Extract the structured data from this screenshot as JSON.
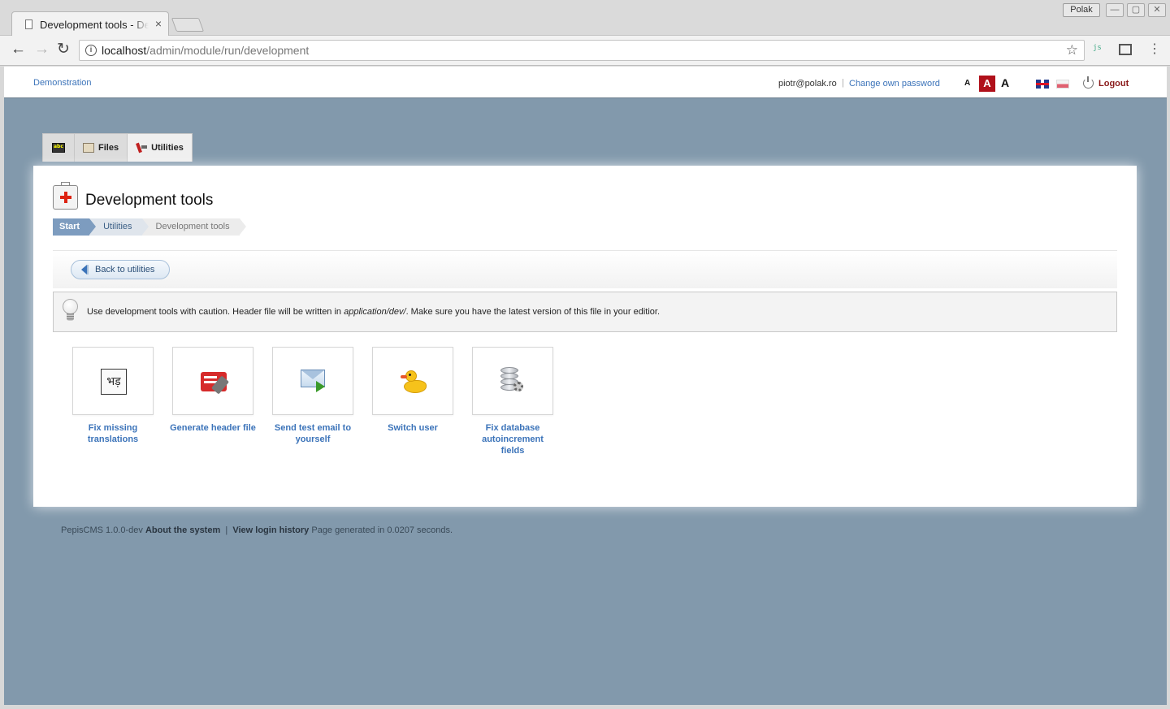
{
  "browser": {
    "tab_title": "Development tools - Development tools",
    "tab_close": "×",
    "profile_name": "Polak",
    "win_min": "—",
    "win_max": "▢",
    "win_close": "✕",
    "url_host": "localhost",
    "url_path": "/admin/module/run/development",
    "back_glyph": "←",
    "forward_glyph": "→",
    "reload_glyph": "↻",
    "info_glyph": "i",
    "star_glyph": "☆",
    "ext_label": "js",
    "menu_glyph": "⋮"
  },
  "topbar": {
    "site_name": "Demonstration",
    "user_email": "piotr@polak.ro",
    "separator": "|",
    "change_password": "Change own password",
    "font_small": "A",
    "font_medium": "A",
    "font_large": "A",
    "logout": "Logout"
  },
  "menu": {
    "items": [
      {
        "label": "",
        "icon": "home-icon"
      },
      {
        "label": "Files",
        "icon": "files-icon"
      },
      {
        "label": "Utilities",
        "icon": "utilities-icon"
      }
    ]
  },
  "main": {
    "title": "Development tools",
    "breadcrumb": [
      "Start",
      "Utilities",
      "Development tools"
    ],
    "back_button": "Back to utilities",
    "notice_before": "Use development tools with caution. Header file will be written in ",
    "notice_path": "application/dev/",
    "notice_after": ". Make sure you have the latest version of this file in your editior.",
    "tools": [
      {
        "label": "Fix missing translations",
        "icon": "translations-icon",
        "glyph": "भड़"
      },
      {
        "label": "Generate header file",
        "icon": "header-file-icon"
      },
      {
        "label": "Send test email to yourself",
        "icon": "email-icon"
      },
      {
        "label": "Switch user",
        "icon": "duck-icon"
      },
      {
        "label": "Fix database autoincrement fields",
        "icon": "database-icon"
      }
    ]
  },
  "footer": {
    "version": "PepisCMS 1.0.0-dev",
    "about": "About the system",
    "separator": "|",
    "login_history": "View login history",
    "generated": "Page generated in 0.0207 seconds."
  },
  "colors": {
    "page_bg": "#8299ac",
    "link": "#3b73b9",
    "accent_red": "#b0101a"
  }
}
